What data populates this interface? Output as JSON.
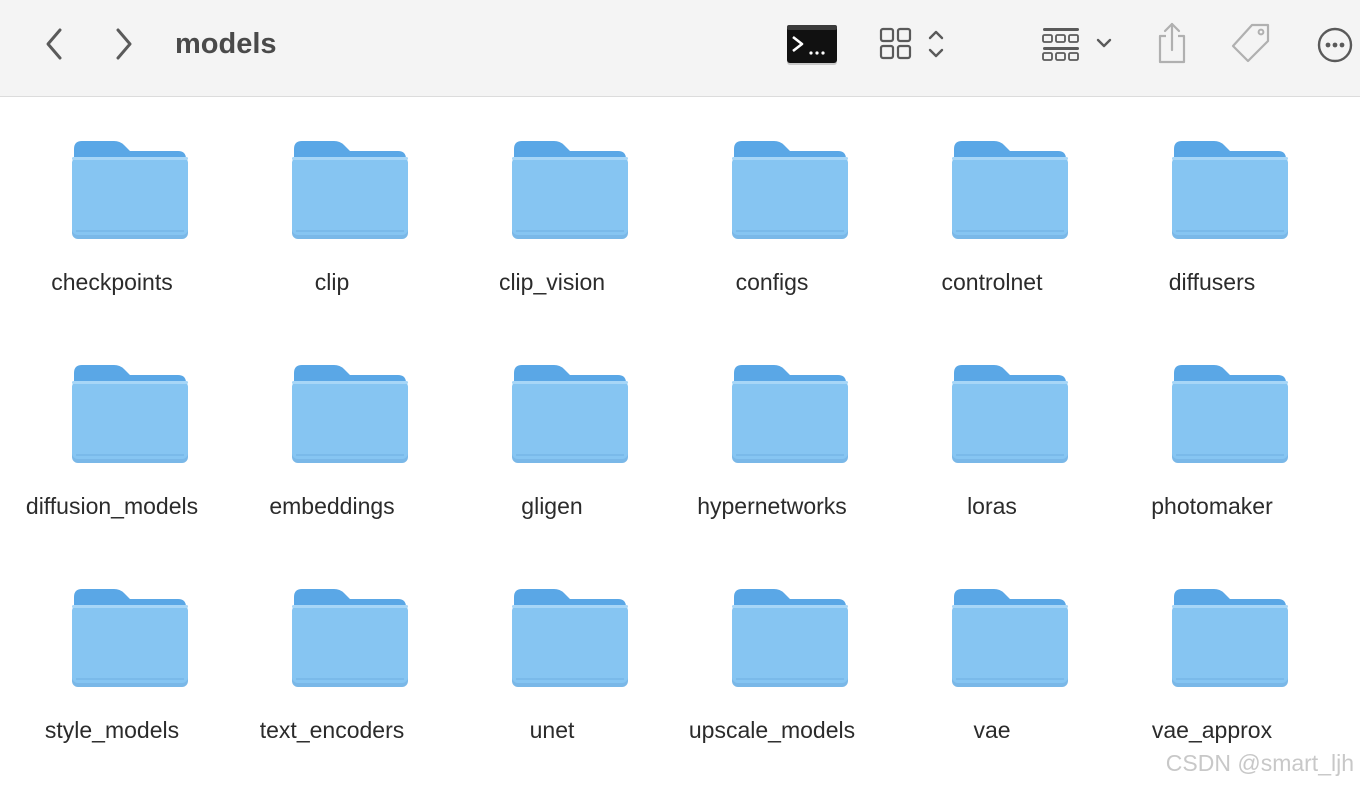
{
  "window": {
    "title": "models"
  },
  "toolbar": {
    "back": {
      "icon": "chevron-left-icon"
    },
    "forward": {
      "icon": "chevron-right-icon"
    },
    "terminal": {
      "icon": "terminal-icon"
    },
    "view": {
      "icon": "icon-grid-view-icon"
    },
    "group": {
      "icon": "group-by-icon"
    },
    "share": {
      "icon": "share-icon"
    },
    "tag": {
      "icon": "tag-icon"
    },
    "more": {
      "icon": "more-options-icon"
    }
  },
  "colors": {
    "folder_body": "#86c5f2",
    "folder_tab": "#5aa7e6",
    "toolbar_bg": "#f4f4f4",
    "text": "#2b2b2b"
  },
  "folders": [
    {
      "name": "checkpoints"
    },
    {
      "name": "clip"
    },
    {
      "name": "clip_vision"
    },
    {
      "name": "configs"
    },
    {
      "name": "controlnet"
    },
    {
      "name": "diffusers"
    },
    {
      "name": "diffusion_models"
    },
    {
      "name": "embeddings"
    },
    {
      "name": "gligen"
    },
    {
      "name": "hypernetworks"
    },
    {
      "name": "loras"
    },
    {
      "name": "photomaker"
    },
    {
      "name": "style_models"
    },
    {
      "name": "text_encoders"
    },
    {
      "name": "unet"
    },
    {
      "name": "upscale_models"
    },
    {
      "name": "vae"
    },
    {
      "name": "vae_approx"
    }
  ],
  "watermark": "CSDN @smart_ljh"
}
